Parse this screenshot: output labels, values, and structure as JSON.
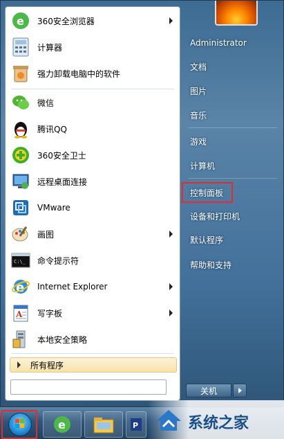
{
  "start_menu": {
    "pinned_items": [
      {
        "label": "360安全浏览器",
        "icon": "360-browser-icon",
        "has_submenu": true
      },
      {
        "label": "计算器",
        "icon": "calculator-icon",
        "has_submenu": false
      },
      {
        "label": "强力卸载电脑中的软件",
        "icon": "uninstall-icon",
        "has_submenu": false
      }
    ],
    "recent_items": [
      {
        "label": "微信",
        "icon": "wechat-icon",
        "has_submenu": false
      },
      {
        "label": "腾讯QQ",
        "icon": "qq-icon",
        "has_submenu": false
      },
      {
        "label": "360安全卫士",
        "icon": "360-guard-icon",
        "has_submenu": false
      },
      {
        "label": "远程桌面连接",
        "icon": "remote-desktop-icon",
        "has_submenu": false
      },
      {
        "label": "VMware",
        "icon": "vmware-icon",
        "has_submenu": false
      },
      {
        "label": "画图",
        "icon": "paint-icon",
        "has_submenu": true
      },
      {
        "label": "命令提示符",
        "icon": "cmd-icon",
        "has_submenu": false
      },
      {
        "label": "Internet Explorer",
        "icon": "ie-icon",
        "has_submenu": true
      },
      {
        "label": "写字板",
        "icon": "wordpad-icon",
        "has_submenu": true
      },
      {
        "label": "本地安全策略",
        "icon": "security-policy-icon",
        "has_submenu": false
      }
    ],
    "all_programs_label": "所有程序",
    "search_placeholder": "",
    "right_items": [
      {
        "label": "Administrator"
      },
      {
        "label": "文档"
      },
      {
        "label": "图片"
      },
      {
        "label": "音乐"
      },
      {
        "label": "游戏"
      },
      {
        "label": "计算机"
      },
      {
        "label": "控制面板",
        "highlighted": true
      },
      {
        "label": "设备和打印机"
      },
      {
        "label": "默认程序"
      },
      {
        "label": "帮助和支持"
      }
    ],
    "shutdown_label": "关机"
  },
  "watermark": {
    "text": "系统之家"
  },
  "colors": {
    "highlight_border": "#e32d2d",
    "menu_blue": "#42709a",
    "accent_orange": "#ff8a00"
  }
}
